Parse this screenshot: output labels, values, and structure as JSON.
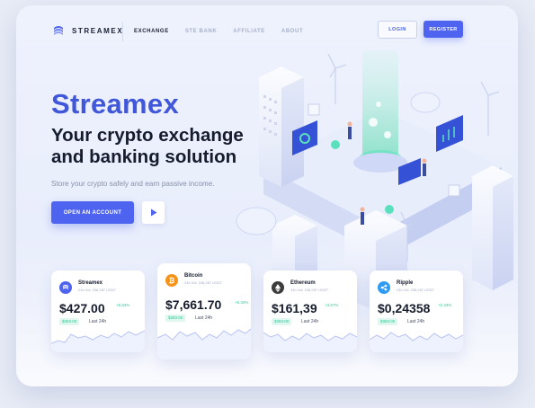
{
  "brand": {
    "name": "STREAMEX"
  },
  "nav": {
    "items": [
      "EXCHANGE",
      "STE BANK",
      "AFFILIATE",
      "ABOUT"
    ],
    "active": "EXCHANGE"
  },
  "auth": {
    "login_label": "LOGIN",
    "register_label": "REGISTER"
  },
  "hero": {
    "title": "Streamex",
    "subtitle": "Your crypto exchange and banking solution",
    "description": "Store your crypto safely and earn passive income.",
    "cta_label": "OPEN AN ACCOUNT"
  },
  "cards": [
    {
      "name": "Streamex",
      "volume": "24h Vol: 238,287 USDT",
      "price": "$427.00",
      "change": "+6.84%",
      "badge": "$383.00",
      "period": "Last 24h",
      "icon": "streamex-coin-icon",
      "color": "#4e63ef"
    },
    {
      "name": "Bitcoin",
      "volume": "24h Vol: 238,287 USDT",
      "price": "$7,661.70",
      "change": "+6.34%",
      "badge": "$383.00",
      "period": "Last 24h",
      "icon": "bitcoin-icon",
      "color": "#f7931a"
    },
    {
      "name": "Ethereum",
      "volume": "24h Vol: 238,287 USDT",
      "price": "$161,39",
      "change": "+3.67%",
      "badge": "$383.00",
      "period": "Last 24h",
      "icon": "ethereum-icon",
      "color": "#3c3c3d"
    },
    {
      "name": "Ripple",
      "volume": "24h Vol: 238,287 USDT",
      "price": "$0,24358",
      "change": "+2.43%",
      "badge": "$383.00",
      "period": "Last 24h",
      "icon": "ripple-icon",
      "color": "#2f9bf3"
    }
  ],
  "colors": {
    "accent": "#4e63ef",
    "positive": "#2ec89a",
    "dark": "#161c2d"
  }
}
